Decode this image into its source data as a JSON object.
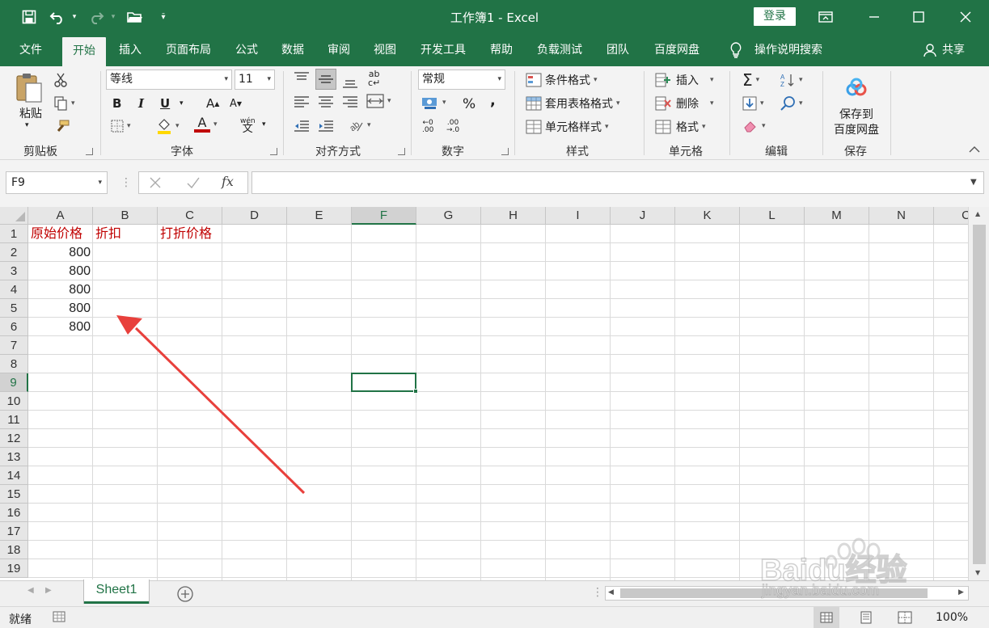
{
  "window": {
    "title": "工作簿1  -  Excel",
    "login": "登录"
  },
  "tabs": [
    "文件",
    "开始",
    "插入",
    "页面布局",
    "公式",
    "数据",
    "审阅",
    "视图",
    "开发工具",
    "帮助",
    "负载测试",
    "团队",
    "百度网盘"
  ],
  "active_tab": "开始",
  "search_label": "操作说明搜索",
  "share_label": "共享",
  "ribbon": {
    "clipboard": {
      "paste": "粘贴",
      "label": "剪贴板"
    },
    "font": {
      "name": "等线",
      "size": "11",
      "label": "字体",
      "bold": "B",
      "italic": "I",
      "underline": "U",
      "font_color_letter": "A",
      "grow": "A",
      "shrink": "A",
      "phonetic": "wén"
    },
    "alignment": {
      "label": "对齐方式"
    },
    "number": {
      "format": "常规",
      "percent": "%",
      "comma": ",",
      "label": "数字"
    },
    "styles": {
      "conditional": "条件格式",
      "table": "套用表格格式",
      "cell_styles": "单元格样式",
      "label": "样式"
    },
    "cells": {
      "insert": "插入",
      "delete": "删除",
      "format": "格式",
      "label": "单元格"
    },
    "editing": {
      "label": "编辑"
    },
    "save": {
      "line1": "保存到",
      "line2": "百度网盘",
      "label": "保存"
    }
  },
  "formula_bar": {
    "name_box": "F9",
    "fx": "fx",
    "content": ""
  },
  "columns": [
    "A",
    "B",
    "C",
    "D",
    "E",
    "F",
    "G",
    "H",
    "I",
    "J",
    "K",
    "L",
    "M",
    "N",
    "C"
  ],
  "rows": [
    "1",
    "2",
    "3",
    "4",
    "5",
    "6",
    "7",
    "8",
    "9",
    "10",
    "11",
    "12",
    "13",
    "14",
    "15",
    "16",
    "17",
    "18",
    "19"
  ],
  "selected_cell": "F9",
  "cells": {
    "A1": "原始价格",
    "B1": "折扣",
    "C1": "打折价格",
    "A2": "800",
    "A3": "800",
    "A4": "800",
    "A5": "800",
    "A6": "800"
  },
  "sheet_tabs": [
    "Sheet1"
  ],
  "status": {
    "ready": "就绪",
    "zoom": "100%"
  },
  "watermark": {
    "brand": "Baidu经验",
    "url": "jingyan.baidu.com"
  },
  "colors": {
    "excel_green": "#217346",
    "header_text_red": "#c00000",
    "annotation_arrow": "#e8403c"
  }
}
